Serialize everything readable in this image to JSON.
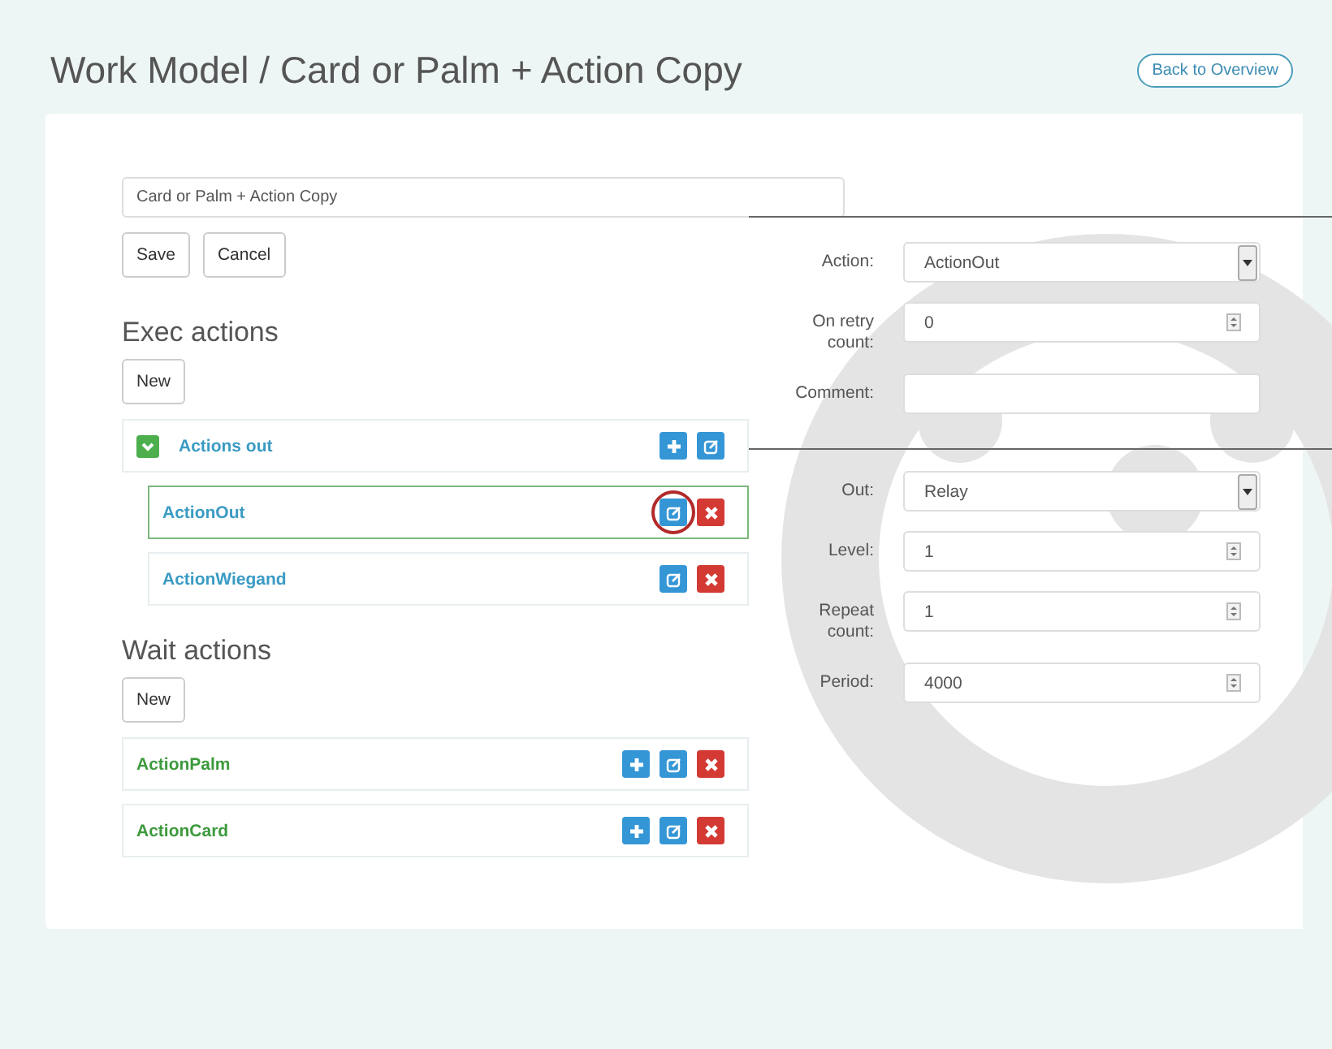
{
  "title": "Work Model / Card or Palm + Action Copy",
  "back_button": "Back to Overview",
  "name_field": {
    "value": "Card or Palm + Action Copy"
  },
  "form_buttons": [
    "Save",
    "Cancel"
  ],
  "sections": [
    {
      "heading": "Exec actions",
      "new_button": "New",
      "items": [
        {
          "label": "Actions out",
          "color": "#3a9bc4",
          "expanded": true,
          "selected": false,
          "actions": [
            {
              "kind": "add",
              "circled": false
            },
            {
              "kind": "edit",
              "circled": false
            }
          ],
          "children": [
            {
              "label": "ActionOut",
              "color": "#3a9bc4",
              "selected": true,
              "actions": [
                {
                  "kind": "edit",
                  "circled": true
                },
                {
                  "kind": "delete",
                  "circled": false
                }
              ]
            },
            {
              "label": "ActionWiegand",
              "color": "#3a9bc4",
              "selected": false,
              "actions": [
                {
                  "kind": "edit",
                  "circled": false
                },
                {
                  "kind": "delete",
                  "circled": false
                }
              ]
            }
          ]
        }
      ]
    },
    {
      "heading": "Wait actions",
      "new_button": "New",
      "items": [
        {
          "label": "ActionPalm",
          "color": "#3d9a3d",
          "selected": false,
          "actions": [
            {
              "kind": "add",
              "circled": false
            },
            {
              "kind": "edit",
              "circled": false
            },
            {
              "kind": "delete",
              "circled": false
            }
          ]
        },
        {
          "label": "ActionCard",
          "color": "#3d9a3d",
          "selected": false,
          "actions": [
            {
              "kind": "add",
              "circled": false
            },
            {
              "kind": "edit",
              "circled": false
            },
            {
              "kind": "delete",
              "circled": false
            }
          ]
        }
      ]
    }
  ],
  "field_groups": [
    [
      {
        "label": "Action:",
        "kind": "select",
        "value": "ActionOut"
      },
      {
        "label": "On retry count:",
        "kind": "number",
        "value": "0"
      },
      {
        "label": "Comment:",
        "kind": "text"
      }
    ],
    [
      {
        "label": "Out:",
        "kind": "select",
        "value": "Relay"
      },
      {
        "label": "Level:",
        "kind": "number",
        "value": "1"
      },
      {
        "label": "Repeat count:",
        "kind": "number",
        "value": "1"
      },
      {
        "label": "Period:",
        "kind": "number",
        "value": "4000"
      }
    ]
  ]
}
